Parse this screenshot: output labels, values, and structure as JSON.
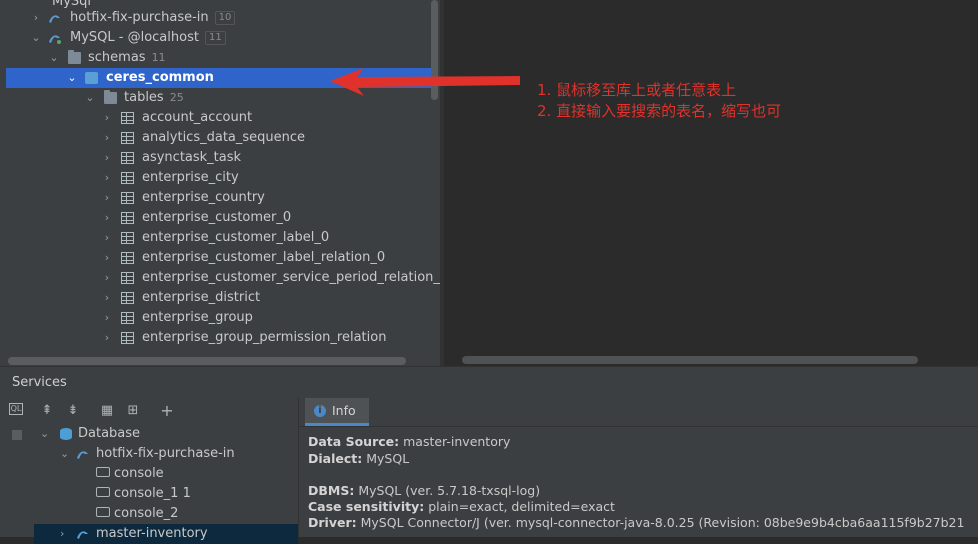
{
  "tree": {
    "top_partial": "MySql",
    "rows": [
      {
        "label": "hotfix-fix-purchase-in",
        "count": "10"
      },
      {
        "label": "MySQL - @localhost",
        "count": "11"
      },
      {
        "label": "schemas",
        "count": "11"
      },
      {
        "label": "ceres_common"
      },
      {
        "label": "tables",
        "count": "25"
      }
    ],
    "tables": [
      "account_account",
      "analytics_data_sequence",
      "asynctask_task",
      "enterprise_city",
      "enterprise_country",
      "enterprise_customer_0",
      "enterprise_customer_label_0",
      "enterprise_customer_label_relation_0",
      "enterprise_customer_service_period_relation_",
      "enterprise_district",
      "enterprise_group",
      "enterprise_group_permission_relation"
    ]
  },
  "annotation": {
    "line1": "1. 鼠标移至库上或者任意表上",
    "line2": "2. 直接输入要搜索的表名，缩写也可",
    "color": "#e0322b"
  },
  "services": {
    "title": "Services",
    "tree": {
      "root": "Database",
      "connection": "hotfix-fix-purchase-in",
      "consoles": [
        "console",
        "console_1 1",
        "console_2"
      ],
      "next_partial": "master-inventory"
    },
    "info": {
      "tab_label": "Info",
      "data_source_label": "Data Source:",
      "data_source_value": "master-inventory",
      "dialect_label": "Dialect:",
      "dialect_value": "MySQL",
      "dbms_label": "DBMS:",
      "dbms_value": "MySQL (ver. 5.7.18-txsql-log)",
      "case_label": "Case sensitivity:",
      "case_value": "plain=exact, delimited=exact",
      "driver_label": "Driver:",
      "driver_value": "MySQL Connector/J (ver. mysql-connector-java-8.0.25 (Revision: 08be9e9b4cba6aa115f9b27b21"
    }
  },
  "colors": {
    "selection": "#2f65ca",
    "panel": "#3c3f41",
    "editor": "#2b2b2b",
    "arrow": "#e0322b"
  }
}
